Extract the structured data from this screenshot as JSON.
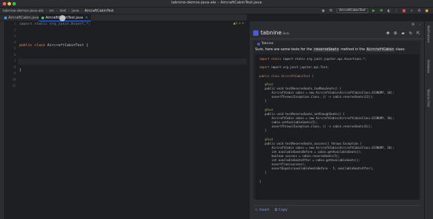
{
  "window": {
    "title": "tabnine-demos-java-ale – AircraftCabinTest.java",
    "light_colors": [
      "#ff5f57",
      "#febc2e",
      "#28c840"
    ]
  },
  "navbar": {
    "project": "tabnine-demos-java-ale",
    "crumbs": [
      "src",
      "test",
      "java"
    ],
    "file": "AircraftCabinTest",
    "run_config": "AircraftCabinTest"
  },
  "tabs": [
    {
      "label": "AircraftCabin.java",
      "active": false
    },
    {
      "label": "AircraftCabinTest.java",
      "active": true
    }
  ],
  "editor": {
    "line_numbers": [
      "1",
      "2",
      "3",
      "4",
      "5",
      "6",
      "7",
      "8",
      "9",
      "10",
      "11"
    ],
    "import_line": "import static org.junit.Assert.*;",
    "class_keyword": "public class",
    "class_name": "AircraftCabinTest {",
    "closing_brace": "}",
    "status": "▲1 ∧ ∨"
  },
  "panel": {
    "brand": "tabnine",
    "brand_badge": "Beta",
    "sender": "Tabnine",
    "intro_prefix": "Sure, here are some tests for the",
    "intro_method": "reserveSeats",
    "intro_middle": "method in the",
    "intro_class": "AircraftCabin",
    "intro_suffix": "class:",
    "code": {
      "l1": "import static org.junit.jupiter.api.Assertions.*;",
      "l2": "import org.junit.jupiter.api.Test;",
      "l3": "public class AircraftCabinTest {",
      "test1": {
        "annotation": "@Test",
        "sig": "public void testReserveSeats_tooManySeats() {",
        "body1": "AircraftCabin cabin = new AircraftCabin(AircraftCabinClass.ECONOMY, 10);",
        "body2": "assertThrows(Exception.class, () -> cabin.reserveSeats(11));",
        "close": "}"
      },
      "test2": {
        "annotation": "@Test",
        "sig": "public void testReserveSeats_notEnoughSeats() {",
        "body1": "AircraftCabin cabin = new AircraftCabin(AircraftCabinClass.ECONOMY, 10);",
        "body2": "cabin.setAvailableSeats(5);",
        "body3": "assertThrows(Exception.class, () -> cabin.reserveSeats(6));",
        "close": "}"
      },
      "test3": {
        "annotation": "@Test",
        "sig": "public void testReserveSeats_success() throws Exception {",
        "body1": "AircraftCabin cabin = new AircraftCabin(AircraftCabinClass.ECONOMY, 10);",
        "body2": "int availableSeatsBefore = cabin.getAvailableSeats();",
        "body3": "boolean success = cabin.reserveSeats(5);",
        "body4": "int availableSeatsAfter = cabin.getAvailableSeats();",
        "body5": "assertTrue(success);",
        "body6": "assertEquals(availableSeatsBefore - 5, availableSeatsAfter);",
        "close": "}"
      },
      "final_close": "}"
    },
    "actions": {
      "insert": "Insert",
      "copy": "Copy"
    }
  },
  "right_tools": [
    "Notifications",
    "Database",
    "Tabnine Chat"
  ],
  "colors": {
    "accent": "#3574f0",
    "brand": "#4b5ad8",
    "link": "#6b9cf0"
  }
}
